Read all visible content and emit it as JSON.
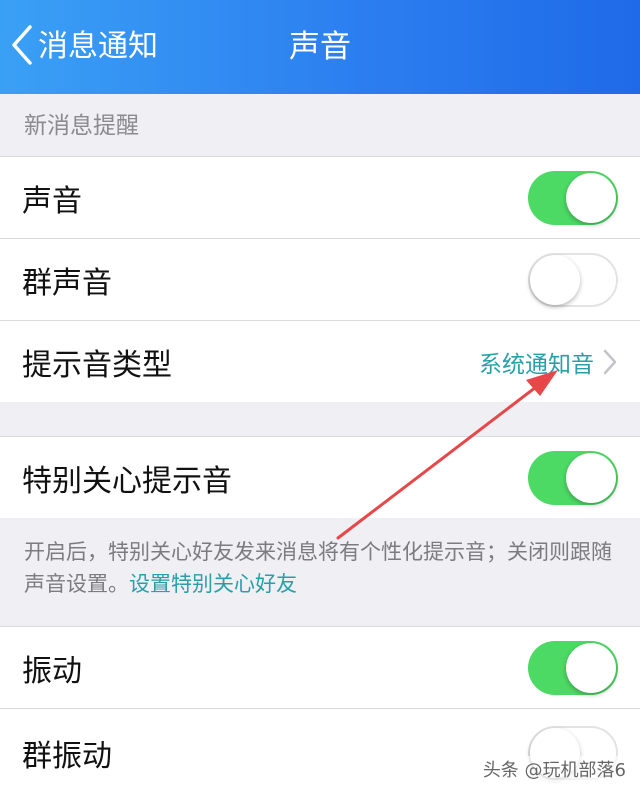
{
  "nav": {
    "back_label": "消息通知",
    "title": "声音"
  },
  "section_header": "新消息提醒",
  "rows": {
    "sound": {
      "label": "声音",
      "toggle": "on"
    },
    "group_sound": {
      "label": "群声音",
      "toggle": "off"
    },
    "tone_type": {
      "label": "提示音类型",
      "value": "系统通知音"
    },
    "special_care": {
      "label": "特别关心提示音",
      "toggle": "on"
    },
    "vibrate": {
      "label": "振动",
      "toggle": "on"
    },
    "group_vibrate": {
      "label": "群振动",
      "toggle": "off"
    }
  },
  "footnote": {
    "text": "开启后，特别关心好友发来消息将有个性化提示音；关闭则跟随声音设置。",
    "link": "设置特别关心好友"
  },
  "watermark": "头条 @玩机部落6",
  "colors": {
    "nav_gradient_start": "#3aa0f5",
    "nav_gradient_end": "#1f6ae8",
    "toggle_on": "#4cd964",
    "link": "#2a9fa8",
    "annotation_arrow": "#e8474a"
  }
}
